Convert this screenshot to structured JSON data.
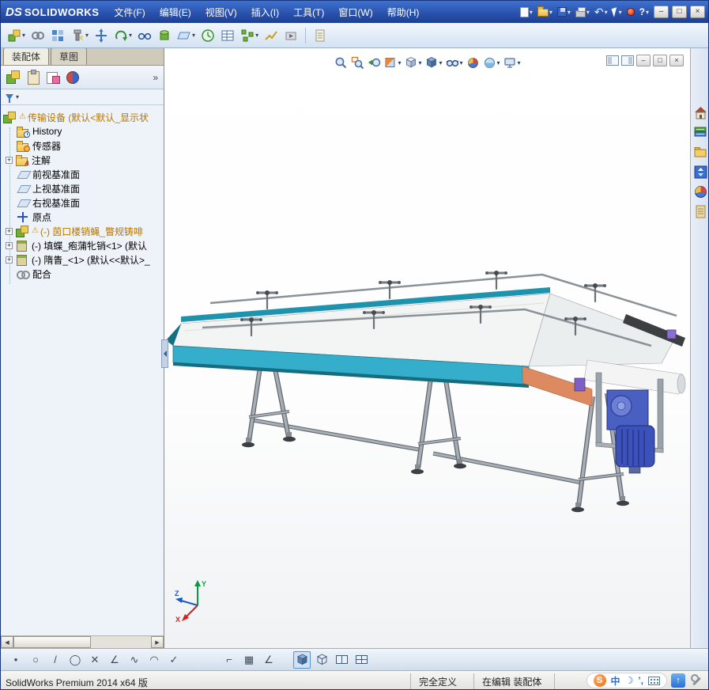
{
  "ui": {
    "dropdown_arrow": "▾",
    "plus": "+",
    "warning": "⚠",
    "chevron_more": "»",
    "scroll_left": "◀",
    "scroll_right": "▶",
    "help": "?",
    "undo": "↶",
    "minimize": "–",
    "restore": "□",
    "close": "×"
  },
  "titlebar": {
    "logo_prefix": "DS",
    "logo": "SOLIDWORKS",
    "menus": [
      "文件(F)",
      "编辑(E)",
      "视图(V)",
      "插入(I)",
      "工具(T)",
      "窗口(W)",
      "帮助(H)"
    ]
  },
  "toolbar": {
    "items": [
      "insert-components",
      "mate",
      "linear-component-pattern",
      "smart-fasteners",
      "move-component",
      "rotate-component",
      "show-hidden-components",
      "assembly-features",
      "reference-geometry",
      "new-motion-study",
      "bill-of-materials",
      "exploded-view",
      "explode-line-sketch",
      "simulation",
      "document-properties"
    ]
  },
  "left_panel": {
    "tabs": [
      {
        "label": "装配体",
        "active": true
      },
      {
        "label": "草图",
        "active": false
      }
    ],
    "panel_icons": [
      "featuremanager",
      "property-manager",
      "configuration-manager",
      "display-manager"
    ],
    "tree": [
      {
        "icon": "assembly",
        "label": "传输设备 (默认<默认_显示状",
        "warning": true
      },
      {
        "icon": "history-folder",
        "label": "History"
      },
      {
        "icon": "sensors-folder",
        "label": "传感器"
      },
      {
        "icon": "annotations-folder",
        "label": "注解",
        "expandable": true
      },
      {
        "icon": "plane",
        "label": "前视基准面"
      },
      {
        "icon": "plane",
        "label": "上视基准面"
      },
      {
        "icon": "plane",
        "label": "右视基准面"
      },
      {
        "icon": "origin",
        "label": "原点"
      },
      {
        "icon": "part",
        "label": "(-) 茵口楼销蝇_瞥规铸啡",
        "warning": true,
        "expandable": true
      },
      {
        "icon": "part",
        "label": "(-) 填蝶_疱蒲牝销<1> (默认",
        "expandable": true
      },
      {
        "icon": "part",
        "label": "(-) 隋眚_<1> (默认<<默认>_",
        "expandable": true
      },
      {
        "icon": "mates",
        "label": "配合"
      }
    ]
  },
  "viewport": {
    "hud": [
      "zoom-fit",
      "zoom-area",
      "previous-view",
      "section-view",
      "view-orientation",
      "display-style",
      "hide-show-items",
      "edit-appearance",
      "apply-scene",
      "view-settings"
    ],
    "triad": {
      "x": "X",
      "y": "Y",
      "z": "Z"
    }
  },
  "task_pane": {
    "items": [
      "solidworks-resources",
      "design-library",
      "file-explorer",
      "view-palette",
      "appearances-scenes",
      "custom-properties"
    ]
  },
  "sketch_toolbar": {
    "items": [
      {
        "name": "point-tool",
        "glyph": "•"
      },
      {
        "name": "circle-tool",
        "glyph": "○"
      },
      {
        "name": "line-tool",
        "glyph": "/"
      },
      {
        "name": "ellipse-tool",
        "glyph": "◯"
      },
      {
        "name": "trim-tool",
        "glyph": "✕"
      },
      {
        "name": "chamfer-tool",
        "glyph": "∠"
      },
      {
        "name": "spline-tool",
        "glyph": "∿"
      },
      {
        "name": "arc-tool",
        "glyph": "◠"
      },
      {
        "name": "ok-tool",
        "glyph": "✓"
      },
      {
        "name": "selection-frame-tool",
        "glyph": "⌐"
      },
      {
        "name": "grid-snap-tool",
        "glyph": "▦"
      },
      {
        "name": "angle-snap-tool",
        "glyph": "∠"
      }
    ]
  },
  "statusbar": {
    "left": "SolidWorks Premium 2014 x64 版",
    "defined_state": "完全定义",
    "editing_state": "在编辑 装配体",
    "tray": {
      "sogou": "S",
      "mode": "中",
      "moon": "☽",
      "punct": "’,",
      "arrow": "↑"
    }
  }
}
